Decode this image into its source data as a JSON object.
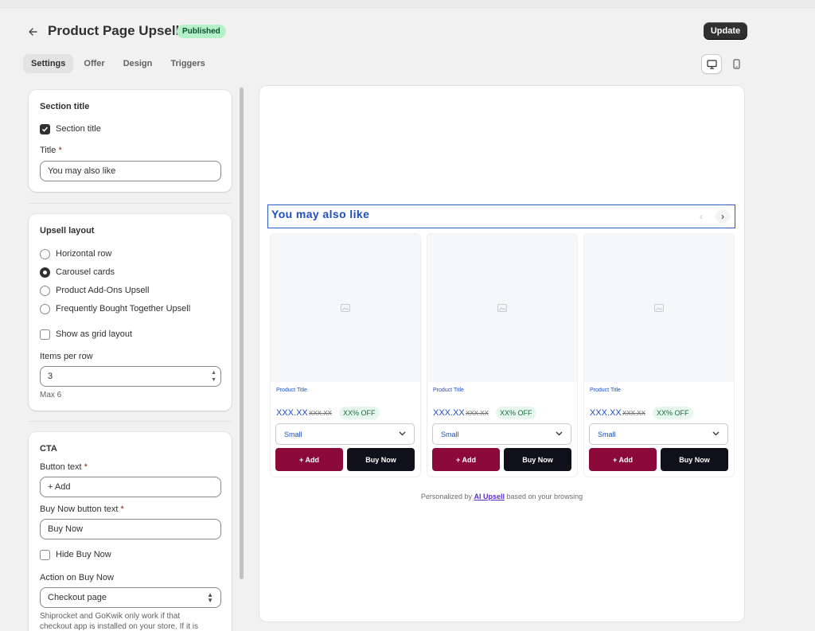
{
  "header": {
    "back_icon": "arrow-left-icon",
    "title": "Product Page Upsell",
    "status_badge": "Published",
    "update_label": "Update"
  },
  "tabs": [
    {
      "label": "Settings",
      "active": true
    },
    {
      "label": "Offer",
      "active": false
    },
    {
      "label": "Design",
      "active": false
    },
    {
      "label": "Triggers",
      "active": false
    }
  ],
  "device_toggle": {
    "selected": "desktop",
    "icons": [
      "desktop-icon",
      "mobile-icon"
    ]
  },
  "section_title_card": {
    "heading": "Section title",
    "checkbox_label": "Section title",
    "checkbox_checked": true,
    "title_label": "Title",
    "required_mark": "*",
    "title_value": "You may also like"
  },
  "upsell_layout_card": {
    "heading": "Upsell layout",
    "options": [
      {
        "label": "Horizontal row",
        "selected": false
      },
      {
        "label": "Carousel cards",
        "selected": true
      },
      {
        "label": "Product Add-Ons Upsell",
        "selected": false
      },
      {
        "label": "Frequently Bought Together Upsell",
        "selected": false
      }
    ],
    "grid_checkbox_label": "Show as grid layout",
    "grid_checkbox_checked": false,
    "items_per_row_label": "Items per row",
    "items_per_row_value": "3",
    "items_per_row_help": "Max 6"
  },
  "cta_card": {
    "heading": "CTA",
    "button_text_label": "Button text",
    "button_text_value": "+ Add",
    "buy_now_label": "Buy Now button text",
    "buy_now_value": "Buy Now",
    "required_mark": "*",
    "hide_buy_now_label": "Hide Buy Now",
    "hide_buy_now_checked": false,
    "action_label": "Action on Buy Now",
    "action_value": "Checkout page",
    "help_line_1": "Shiprocket and GoKwik only work if that",
    "help_line_2": "checkout app is installed on your store. If it is"
  },
  "preview": {
    "section_title": "You may also like",
    "prev_icon": "chevron-left-icon",
    "next_icon": "chevron-right-icon",
    "products": [
      {
        "title": "Product Title",
        "price": "XXX.XX",
        "compare_price": "XXX.XX",
        "discount": "XX% OFF",
        "variant": "Small",
        "add_label": "+ Add",
        "buy_label": "Buy Now"
      },
      {
        "title": "Product Title",
        "price": "XXX.XX",
        "compare_price": "XXX.XX",
        "discount": "XX% OFF",
        "variant": "Small",
        "add_label": "+ Add",
        "buy_label": "Buy Now"
      },
      {
        "title": "Product Title",
        "price": "XXX.XX",
        "compare_price": "XXX.XX",
        "discount": "XX% OFF",
        "variant": "Small",
        "add_label": "+ Add",
        "buy_label": "Buy Now"
      }
    ],
    "footer_prefix": "Personalized by",
    "footer_link": "AI Upsell",
    "footer_suffix": "based on your browsing"
  },
  "colors": {
    "accent_text": "#1f4fbf",
    "add_button": "#8b0a3a",
    "buy_button": "#0f1019",
    "published_badge": "#b4f0c8",
    "footer_link": "#5b2fd1"
  }
}
